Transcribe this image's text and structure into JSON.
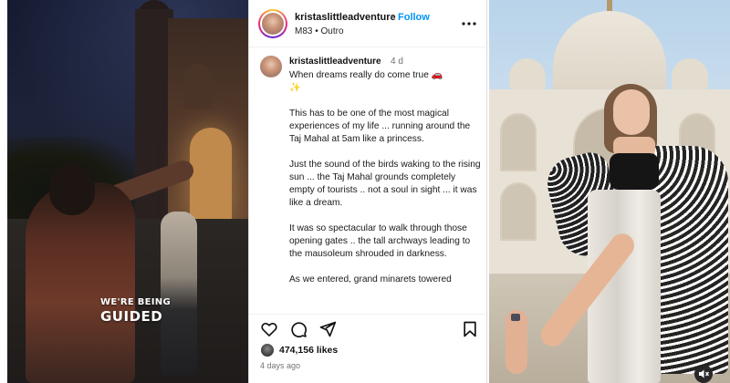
{
  "video": {
    "caption_small": "WE'RE BEING",
    "caption_big": "GUIDED"
  },
  "post": {
    "header": {
      "username": "kristaslittleadventure",
      "separator": "•",
      "follow_label": "Follow",
      "subtitle": "M83 • Outro"
    },
    "caption": {
      "username": "kristaslittleadventure",
      "time": "4 d",
      "paragraphs": [
        "When dreams really do come true",
        "This has to be one of the most magical experiences of my life ... running around the Taj Mahal at 5am like a princess.",
        "Just the sound of the birds waking to the rising sun ... the Taj Mahal grounds completely empty of tourists .. not a soul in sight ... it was like a dream.",
        "It was so spectacular to walk through those opening gates .. the tall archways leading to the mausoleum shrouded in darkness.",
        "As we entered, grand minarets towered"
      ]
    },
    "likes": "474,156 likes",
    "timestamp": "4 days ago"
  },
  "icons": {
    "more": "more-icon",
    "heart": "heart-icon",
    "comment": "comment-icon",
    "share": "send-icon",
    "save": "bookmark-icon",
    "mute": "muted-speaker-icon"
  },
  "colors": {
    "follow_blue": "#0095f6",
    "muted_text": "#737373"
  }
}
